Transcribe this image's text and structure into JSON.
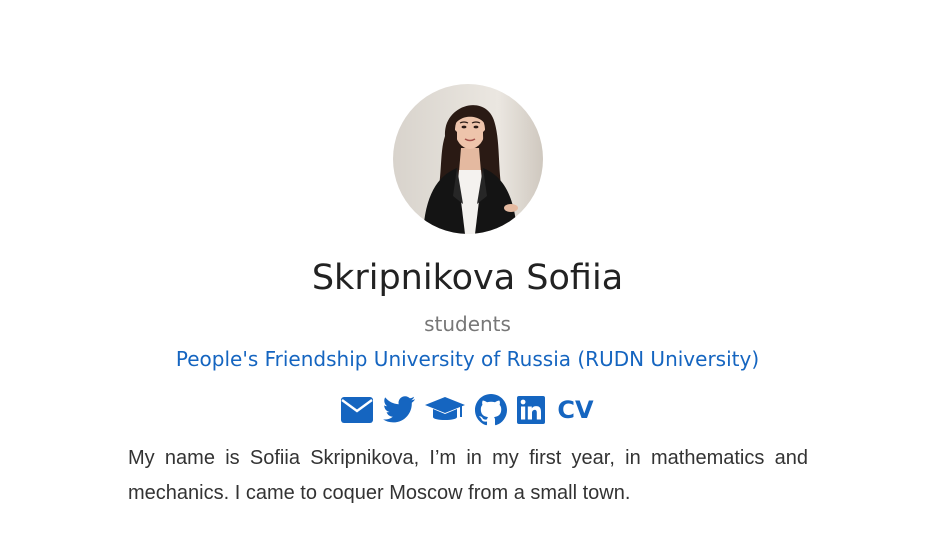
{
  "profile": {
    "avatar_alt": "Skripnikova Sofiia",
    "name": "Skripnikova Sofiia",
    "role": "students",
    "organization": "People's Friendship University of Russia (RUDN University)",
    "links": [
      {
        "icon": "envelope-icon",
        "label": "Email"
      },
      {
        "icon": "twitter-icon",
        "label": "Twitter"
      },
      {
        "icon": "graduation-cap-icon",
        "label": "Google Scholar"
      },
      {
        "icon": "github-icon",
        "label": "GitHub"
      },
      {
        "icon": "linkedin-icon",
        "label": "LinkedIn"
      },
      {
        "icon": "cv-icon",
        "label": "CV"
      }
    ],
    "cv_text": "CV",
    "bio": "My name is Sofiia Skripnikova, I’m in my first year, in mathematics and mechanics. I came to coquer Moscow from a small town."
  },
  "colors": {
    "accent": "#1565c0",
    "name_text": "#222222",
    "role_text": "#777777",
    "body_text": "#333333"
  }
}
